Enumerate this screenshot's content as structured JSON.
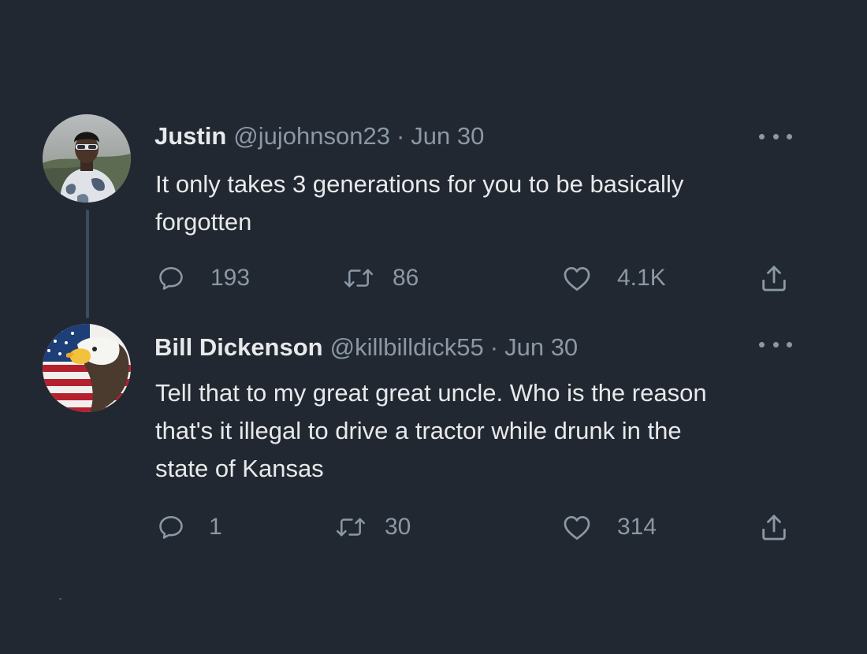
{
  "tweets": [
    {
      "avatar_icon": "person-with-sunglasses-avatar",
      "name": "Justin",
      "handle": "@jujohnson23",
      "separator": "·",
      "date": "Jun 30",
      "text": "It only takes 3 generations for you to be basically\nforgotten",
      "replies": "193",
      "retweets": "86",
      "likes": "4.1K",
      "icons": [
        "reply-icon",
        "retweet-icon",
        "like-icon",
        "share-icon",
        "more-icon"
      ]
    },
    {
      "avatar_icon": "eagle-flag-avatar",
      "name": "Bill Dickenson",
      "handle": "@killbilldick55",
      "separator": "·",
      "date": "Jun 30",
      "text": "Tell that to my great great uncle. Who is the reason\nthat's it illegal to drive a tractor while drunk in the\nstate of Kansas",
      "replies": "1",
      "retweets": "30",
      "likes": "314",
      "icons": [
        "reply-icon",
        "retweet-icon",
        "like-icon",
        "share-icon",
        "more-icon"
      ]
    }
  ],
  "colors": {
    "background": "#222832",
    "primary_text": "#e7e9ea",
    "secondary_text": "#8b98a5",
    "thread_line": "#3d4c5c"
  }
}
